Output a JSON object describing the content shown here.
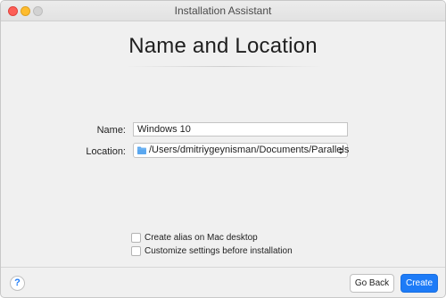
{
  "window": {
    "title": "Installation Assistant"
  },
  "page": {
    "heading": "Name and Location"
  },
  "form": {
    "name_label": "Name:",
    "name_value": "Windows 10",
    "location_label": "Location:",
    "location_value": "/Users/dmitriygeynisman/Documents/Parallels"
  },
  "options": [
    {
      "label": "Create alias on Mac desktop",
      "checked": false
    },
    {
      "label": "Customize settings before installation",
      "checked": false
    }
  ],
  "footer": {
    "help_label": "?",
    "go_back_label": "Go Back",
    "create_label": "Create"
  },
  "colors": {
    "accent": "#1d7bf7",
    "close": "#fd5f57",
    "minimize": "#febc2e",
    "zoom_disabled": "#d2d2d2",
    "folder": "#5aa7ef"
  }
}
